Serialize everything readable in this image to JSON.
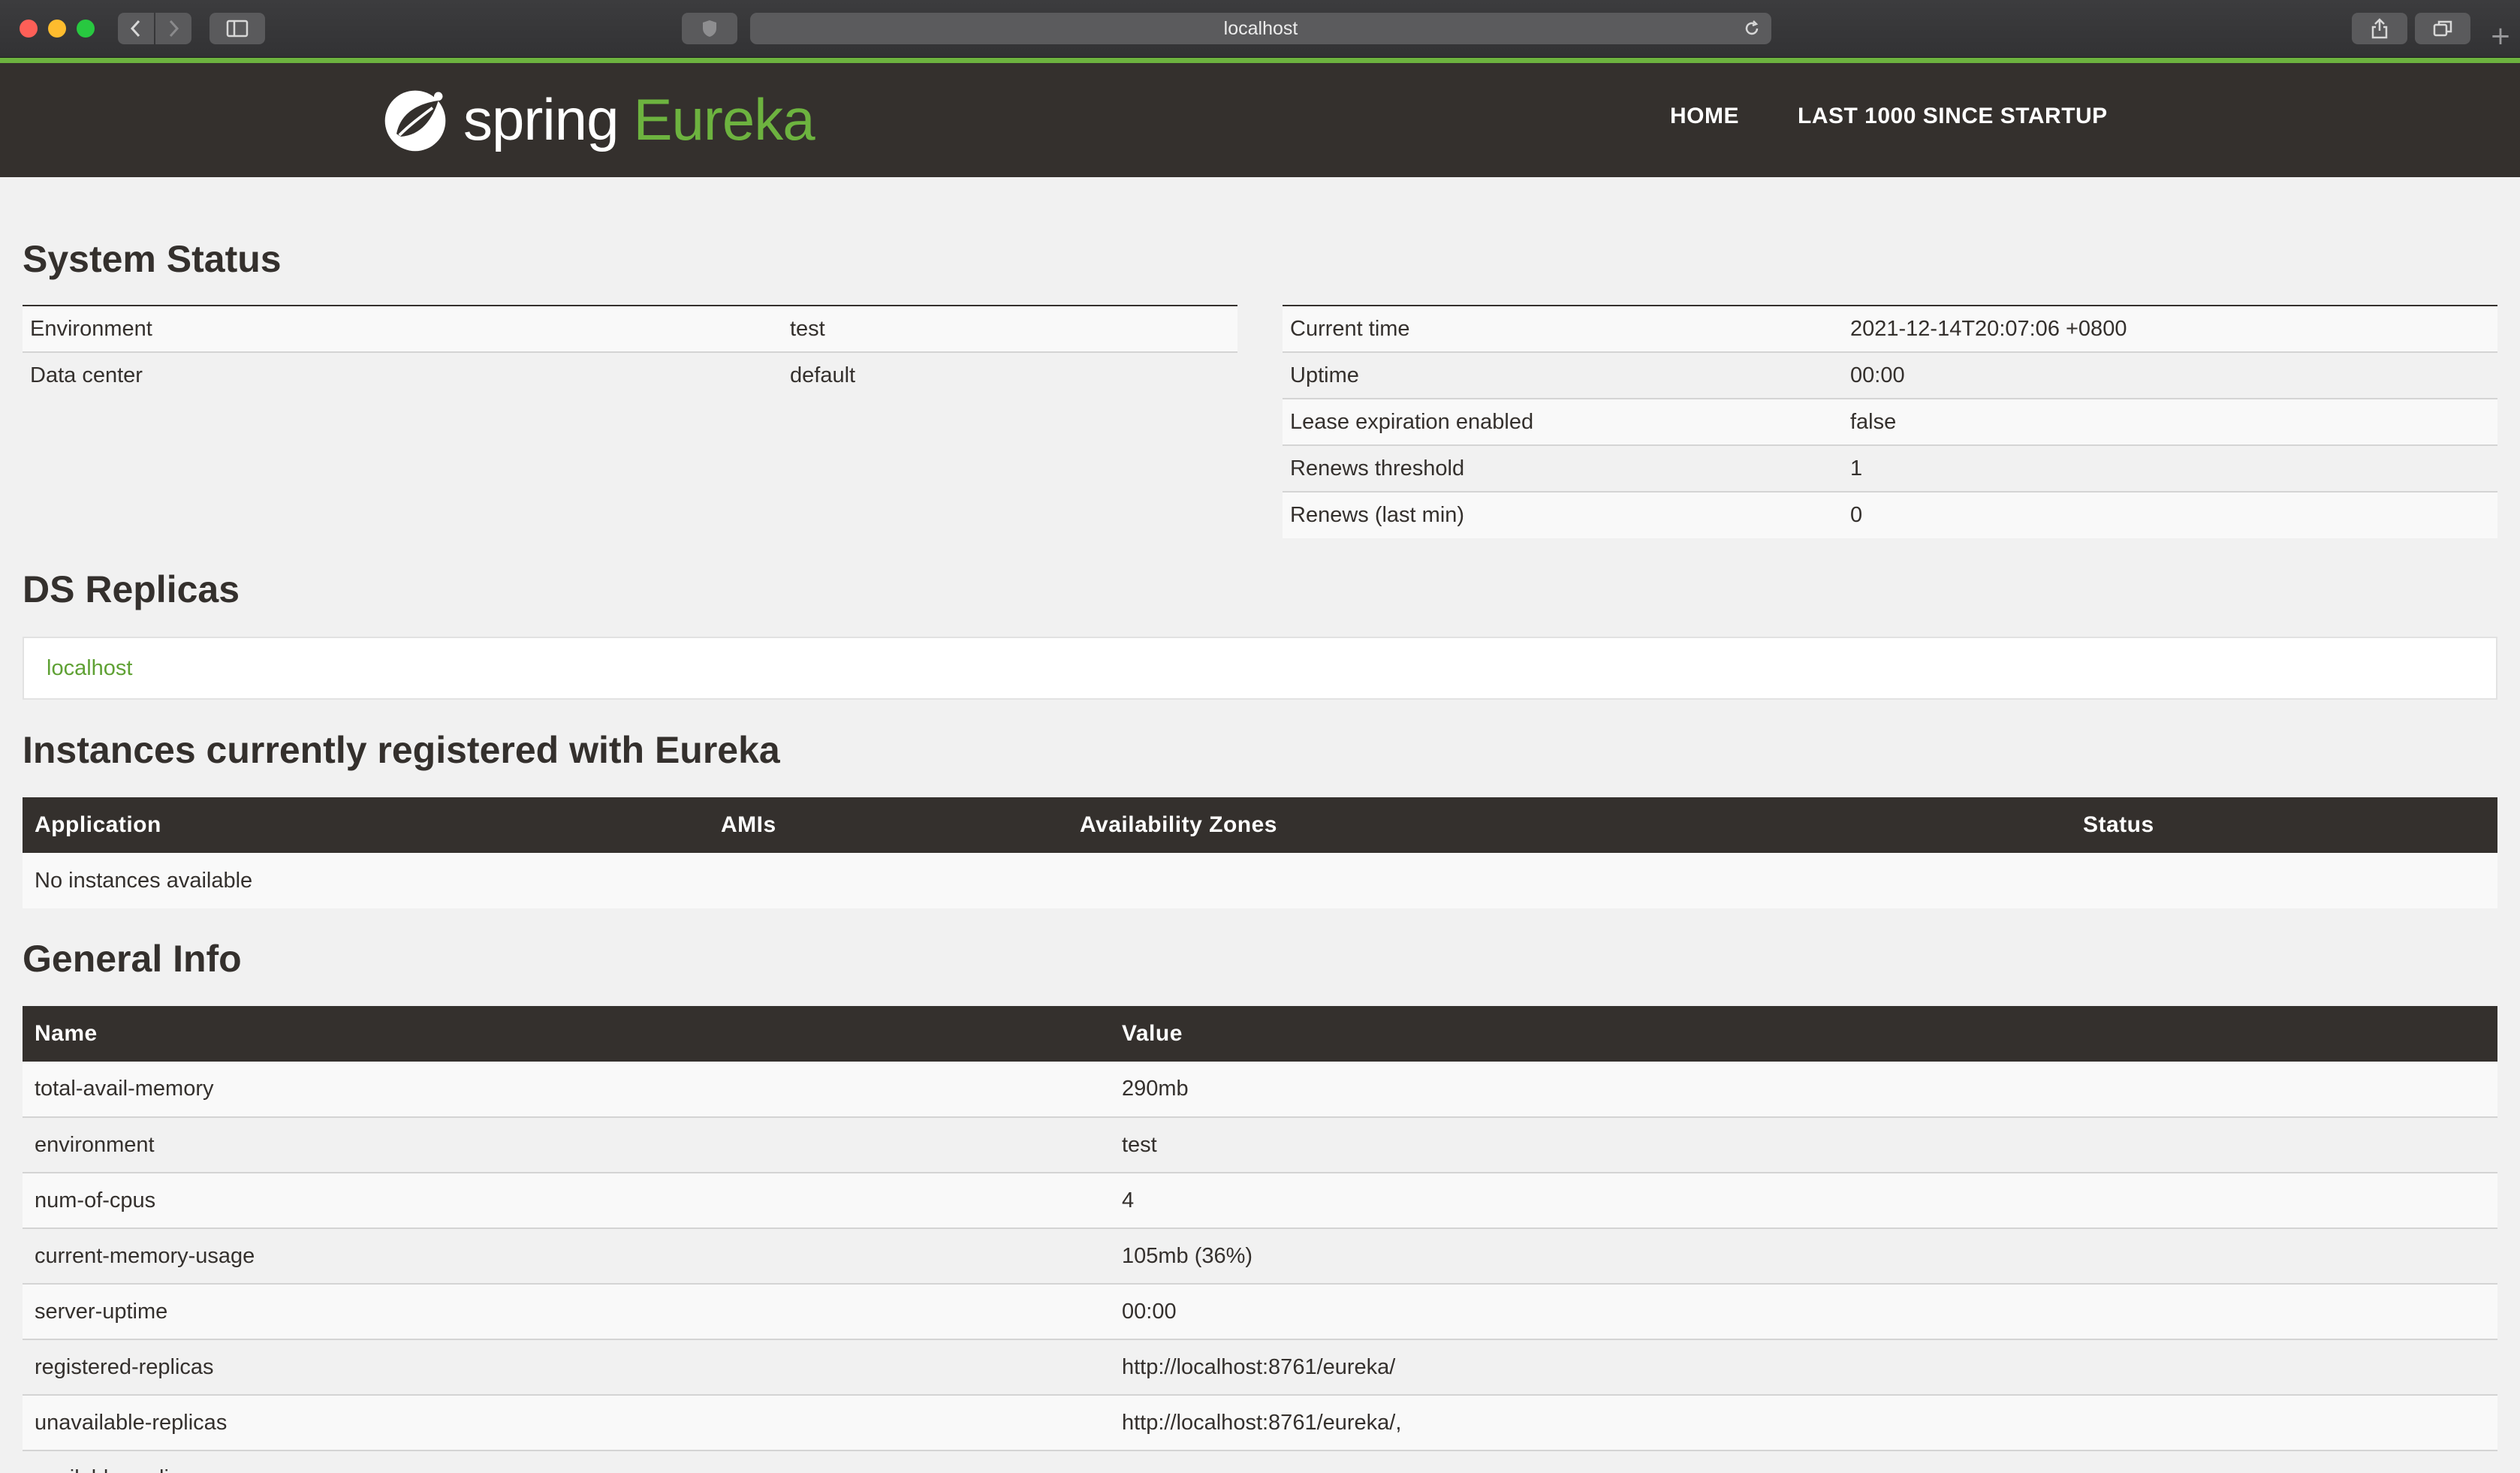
{
  "browser": {
    "url": "localhost",
    "icons": {
      "back": "chevron-left-icon",
      "forward": "chevron-right-icon",
      "sidebar": "sidebar-icon",
      "shield": "shield-icon",
      "reload": "reload-icon",
      "share": "share-icon",
      "tabs": "tabs-icon",
      "new_tab": "plus-icon"
    }
  },
  "brand": {
    "spring": "spring",
    "eureka": "Eureka",
    "accent_color": "#6db33f",
    "navbar_color": "#34302d"
  },
  "nav": {
    "home": "HOME",
    "last1000": "LAST 1000 SINCE STARTUP"
  },
  "system_status": {
    "title": "System Status",
    "left": [
      {
        "label": "Environment",
        "value": "test"
      },
      {
        "label": "Data center",
        "value": "default"
      }
    ],
    "right": [
      {
        "label": "Current time",
        "value": "2021-12-14T20:07:06 +0800"
      },
      {
        "label": "Uptime",
        "value": "00:00"
      },
      {
        "label": "Lease expiration enabled",
        "value": "false"
      },
      {
        "label": "Renews threshold",
        "value": "1"
      },
      {
        "label": "Renews (last min)",
        "value": "0"
      }
    ]
  },
  "ds_replicas": {
    "title": "DS Replicas",
    "items": [
      "localhost"
    ]
  },
  "instances": {
    "title": "Instances currently registered with Eureka",
    "headers": [
      "Application",
      "AMIs",
      "Availability Zones",
      "Status"
    ],
    "empty_text": "No instances available"
  },
  "general_info": {
    "title": "General Info",
    "headers": [
      "Name",
      "Value"
    ],
    "rows": [
      {
        "name": "total-avail-memory",
        "value": "290mb"
      },
      {
        "name": "environment",
        "value": "test"
      },
      {
        "name": "num-of-cpus",
        "value": "4"
      },
      {
        "name": "current-memory-usage",
        "value": "105mb (36%)"
      },
      {
        "name": "server-uptime",
        "value": "00:00"
      },
      {
        "name": "registered-replicas",
        "value": "http://localhost:8761/eureka/"
      },
      {
        "name": "unavailable-replicas",
        "value": "http://localhost:8761/eureka/,"
      },
      {
        "name": "available-replicas",
        "value": ""
      }
    ]
  }
}
